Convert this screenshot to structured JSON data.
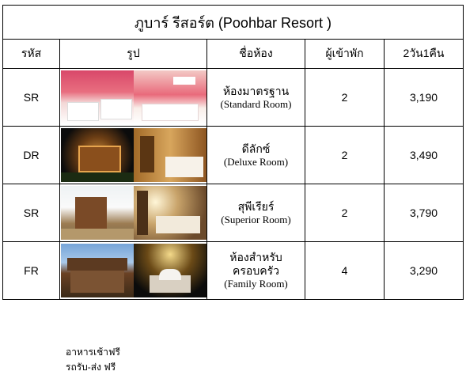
{
  "title": "ภูบาร์ รีสอร์ต (Poohbar Resort )",
  "headers": {
    "code": "รหัส",
    "photo": "รูป",
    "room_name": "ชื่อห้อง",
    "guests": "ผู้เข้าพัก",
    "price": "2วัน1คืน"
  },
  "rooms": [
    {
      "code": "SR",
      "name_th": "ห้องมาตรฐาน",
      "name_en": "(Standard Room)",
      "guests": "2",
      "price": "3,190"
    },
    {
      "code": "DR",
      "name_th": "ดีลักซ์",
      "name_en": "(Deluxe Room)",
      "guests": "2",
      "price": "3,490"
    },
    {
      "code": "SR",
      "name_th": "สุพีเรียร์",
      "name_en": "(Superior Room)",
      "guests": "2",
      "price": "3,790"
    },
    {
      "code": "FR",
      "name_th": "ห้องสำหรับครอบครัว",
      "name_en": "(Family Room)",
      "guests": "4",
      "price": "3,290"
    }
  ],
  "notes": [
    "อาหารเช้าฟรี",
    "รถรับ-ส่ง ฟรี"
  ]
}
